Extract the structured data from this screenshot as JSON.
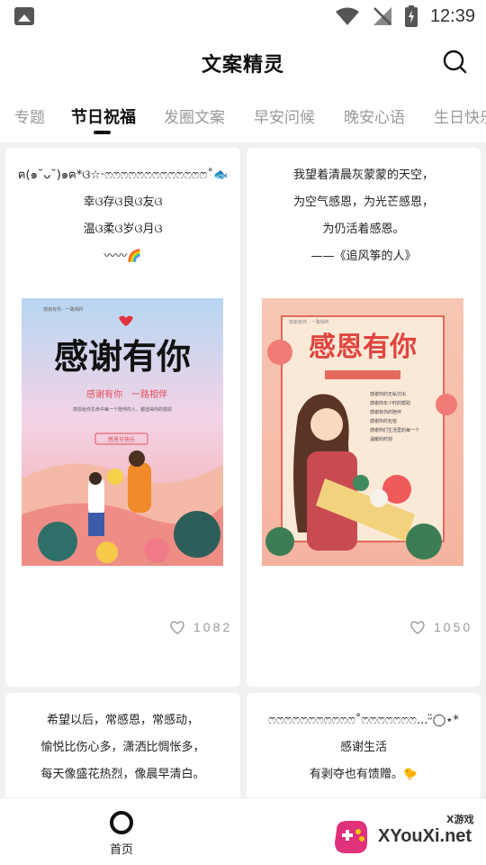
{
  "status": {
    "time": "12:39"
  },
  "header": {
    "title": "文案精灵"
  },
  "tabs": [
    {
      "label": "专题"
    },
    {
      "label": "节日祝福"
    },
    {
      "label": "发圈文案"
    },
    {
      "label": "早安问候"
    },
    {
      "label": "晚安心语"
    },
    {
      "label": "生日快乐"
    }
  ],
  "cards": [
    {
      "lines": [
        "ฅ(๑˘ᴗ˘)๑ฅ*ଓ☆·ෆෆෆෆෆෆෆෆෆෆෆෆෆ˚🐟",
        "幸ଓ存ଓ良ଓ友ଓ",
        "温ଓ柔ଓ岁ଓ月ଓ",
        "〰〰🌈"
      ],
      "poster": {
        "headline": "感谢有你",
        "tagline_left": "感谢有你",
        "tagline_right": "一路相伴",
        "small_text": "感谢有你 · 一路相伴",
        "desc": "感恩给你生命中每一个陪伴的人，都值得你的感恩",
        "button": "感恩节快乐"
      },
      "likes": "1082"
    },
    {
      "lines": [
        "我望着清晨灰蒙蒙的天空，",
        "为空气感恩，为光芒感恩，",
        "为仍活着感恩。",
        "——《追风筝的人》"
      ],
      "poster": {
        "headline": "感恩有你",
        "small_text": "感谢有你 · 一路相伴",
        "body": [
          "感谢你的无私付出",
          "感谢你年少时的帮助",
          "感谢有你的陪伴",
          "感谢你的包容",
          "感谢你们生活里的每一个",
          "温暖的时刻"
        ]
      },
      "likes": "1050"
    },
    {
      "lines": [
        "希望以后，常感恩，常感动，",
        "愉悦比伤心多，潇洒比惆怅多，",
        "每天像盛花热烈，像晨早清白。"
      ]
    },
    {
      "lines": [
        "ෆෆෆෆෆෆෆෆෆෆෆ˚ෆෆෆෆෆෆෆ...ᵕ̈◯⋆*",
        "感谢生活",
        "有剥夺也有馈赠。🐤"
      ]
    }
  ],
  "bottom_nav": {
    "home_label": "首页"
  },
  "watermark": {
    "site": "XYouXi.net",
    "badge": "X游戏"
  },
  "colors": {
    "accent": "#111111",
    "inactive_tab": "#999999",
    "background": "#f1f1f1"
  }
}
